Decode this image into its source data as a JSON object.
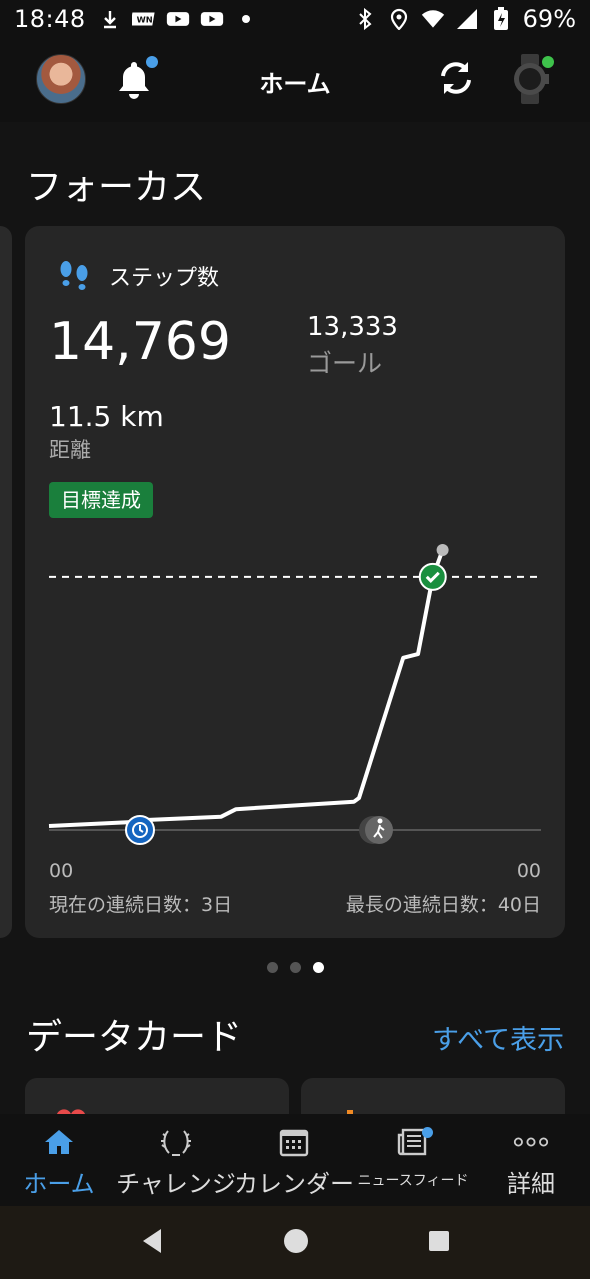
{
  "status_bar": {
    "time": "18:48",
    "battery": "69%"
  },
  "header": {
    "title": "ホーム"
  },
  "focus": {
    "section_title": "フォーカス",
    "card": {
      "label": "ステップ数",
      "steps": "14,769",
      "goal_value": "13,333",
      "goal_label": "ゴール",
      "distance_value": "11.5 km",
      "distance_label": "距離",
      "badge": "目標達成",
      "axis_start": "00",
      "axis_end": "00",
      "current_streak": "現在の連続日数：3日",
      "longest_streak": "最長の連続日数：40日"
    },
    "pager": {
      "count": 3,
      "active_index": 2
    }
  },
  "chart_data": {
    "type": "line",
    "x": [
      0,
      0.16,
      0.18,
      0.35,
      0.38,
      0.62,
      0.63,
      0.72,
      0.75,
      0.78,
      0.8
    ],
    "values": [
      0,
      200,
      300,
      500,
      900,
      1300,
      1500,
      9000,
      9200,
      13333,
      14769
    ],
    "goal": 13333,
    "xlabel": "",
    "ylabel": "",
    "grid": false
  },
  "data_cards": {
    "section_title": "データカード",
    "see_all": "すべて表示"
  },
  "bottom_nav": {
    "items": [
      {
        "label": "ホーム",
        "icon": "home-icon",
        "active": true
      },
      {
        "label": "チャレンジ",
        "icon": "laurel-icon",
        "active": false
      },
      {
        "label": "カレンダー",
        "icon": "calendar-icon",
        "active": false
      },
      {
        "label": "ニュースフィード",
        "icon": "newsfeed-icon",
        "active": false
      },
      {
        "label": "詳細",
        "icon": "more-icon",
        "active": false
      }
    ]
  },
  "colors": {
    "accent": "#4a9fe8",
    "success": "#1a7f3c",
    "card_bg": "#262626"
  }
}
